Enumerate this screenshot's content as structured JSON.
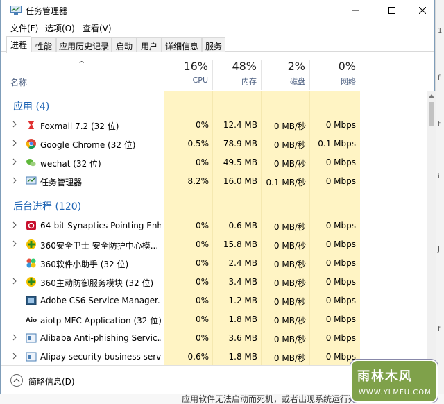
{
  "window": {
    "title": "任务管理器"
  },
  "menu": [
    "文件(F)",
    "选项(O)",
    "查看(V)"
  ],
  "tabs": [
    "进程",
    "性能",
    "应用历史记录",
    "启动",
    "用户",
    "详细信息",
    "服务"
  ],
  "active_tab": "进程",
  "header": {
    "name": "名称",
    "cpu": {
      "pct": "16%",
      "label": "CPU"
    },
    "mem": {
      "pct": "48%",
      "label": "内存"
    },
    "disk": {
      "pct": "2%",
      "label": "磁盘"
    },
    "net": {
      "pct": "0%",
      "label": "网络"
    }
  },
  "groups": {
    "apps": "应用 (4)",
    "background": "后台进程 (120)"
  },
  "apps": [
    {
      "name": "Foxmail 7.2 (32 位)",
      "cpu": "0%",
      "mem": "12.4 MB",
      "disk": "0 MB/秒",
      "net": "0 Mbps",
      "icon": "foxmail-icon"
    },
    {
      "name": "Google Chrome (32 位)",
      "cpu": "0.5%",
      "mem": "78.9 MB",
      "disk": "0 MB/秒",
      "net": "0.1 Mbps",
      "icon": "chrome-icon"
    },
    {
      "name": "wechat (32 位)",
      "cpu": "0%",
      "mem": "49.5 MB",
      "disk": "0 MB/秒",
      "net": "0 Mbps",
      "icon": "wechat-icon"
    },
    {
      "name": "任务管理器",
      "cpu": "8.2%",
      "mem": "16.0 MB",
      "disk": "0.1 MB/秒",
      "net": "0 Mbps",
      "icon": "task-manager-icon"
    }
  ],
  "background": [
    {
      "name": "64-bit Synaptics Pointing Enh...",
      "cpu": "0%",
      "mem": "0.6 MB",
      "disk": "0 MB/秒",
      "net": "0 Mbps",
      "icon": "synaptics-icon"
    },
    {
      "name": "360安全卫士 安全防护中心模...",
      "cpu": "0%",
      "mem": "15.8 MB",
      "disk": "0 MB/秒",
      "net": "0 Mbps",
      "icon": "360-safe-icon"
    },
    {
      "name": "360软件小助手 (32 位)",
      "cpu": "0%",
      "mem": "2.4 MB",
      "disk": "0 MB/秒",
      "net": "0 Mbps",
      "icon": "360-software-icon"
    },
    {
      "name": "360主动防御服务模块 (32 位)",
      "cpu": "0%",
      "mem": "3.4 MB",
      "disk": "0 MB/秒",
      "net": "0 Mbps",
      "icon": "360-defense-icon"
    },
    {
      "name": "Adobe CS6 Service Manager...",
      "cpu": "0%",
      "mem": "1.2 MB",
      "disk": "0 MB/秒",
      "net": "0 Mbps",
      "icon": "adobe-icon"
    },
    {
      "name": "aiotp MFC Application (32 位)",
      "cpu": "0%",
      "mem": "1.8 MB",
      "disk": "0 MB/秒",
      "net": "0 Mbps",
      "icon": "aiotp-icon"
    },
    {
      "name": "Alibaba Anti-phishing Servic...",
      "cpu": "0%",
      "mem": "3.6 MB",
      "disk": "0 MB/秒",
      "net": "0 Mbps",
      "icon": "alibaba-icon"
    },
    {
      "name": "Alipay security business servi...",
      "cpu": "0.6%",
      "mem": "1.8 MB",
      "disk": "0 MB/秒",
      "net": "0 Mbps",
      "icon": "alipay-icon"
    }
  ],
  "footer": {
    "label": "简略信息(D)"
  },
  "watermark": {
    "line1": "雨林木风",
    "line2": "WWW.YLMFU.COM"
  },
  "background_page": {
    "bottom_text": "应用软件无法启动而死机，或者出现系统运行死机"
  },
  "colors": {
    "accent": "#1e64b4",
    "highlight": "#fff4c4",
    "header_label": "#4d6082"
  }
}
